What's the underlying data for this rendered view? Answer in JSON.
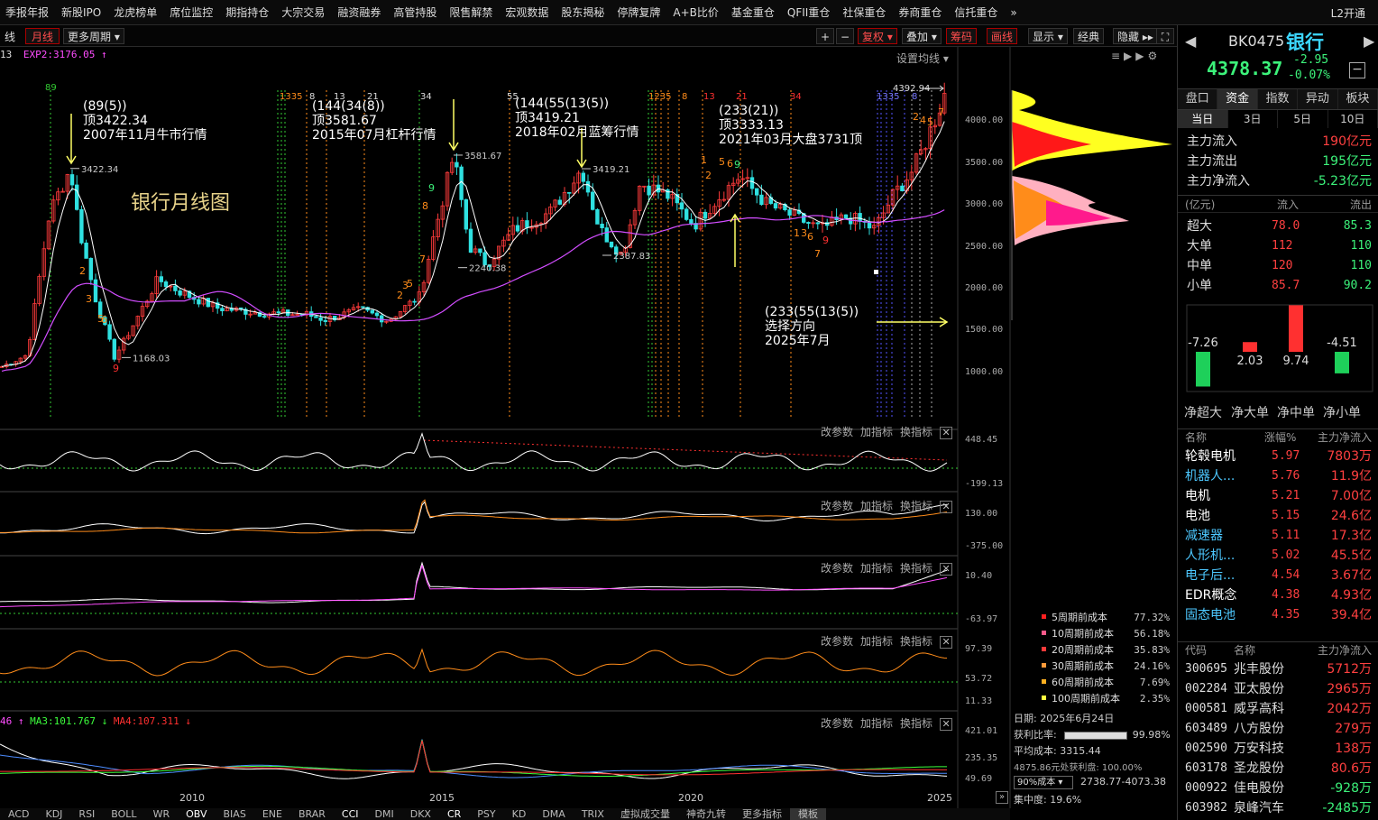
{
  "nav": [
    "季报年报",
    "新股IPO",
    "龙虎榜单",
    "席位监控",
    "期指持仓",
    "大宗交易",
    "融资融券",
    "高管持股",
    "限售解禁",
    "宏观数据",
    "股东揭秘",
    "停牌复牌",
    "A+B比价",
    "基金重仓",
    "QFII重仓",
    "社保重仓",
    "券商重仓",
    "信托重仓"
  ],
  "nav_more": "»",
  "top_right": "L2开通",
  "toolbar": {
    "left_cut": "线",
    "period": "月线",
    "more_period": "更多周期",
    "restore": "复权",
    "overlay": "叠加",
    "chips": "筹码",
    "draw": "画线",
    "display": "显示",
    "classic": "经典",
    "hide": "隐藏",
    "settings_ma": "设置均线"
  },
  "legend": {
    "prefix": "13",
    "exp2": "EXP2:3176.05",
    "bottom_prefix": "46",
    "ma3": "MA3:101.767",
    "ma4": "MA4:107.311"
  },
  "chart_title": "银行月线图",
  "annotations": [
    {
      "lines": [
        "(89(5))",
        "顶3422.34",
        "2007年11月牛市行情"
      ]
    },
    {
      "lines": [
        "(144(34(8))",
        "顶3581.67",
        "2015年07月杠杆行情"
      ]
    },
    {
      "lines": [
        "(144(55(13(5))",
        "顶3419.21",
        "2018年02月蓝筹行情"
      ]
    },
    {
      "lines": [
        "(233(21))",
        "顶3333.13",
        "2021年03月大盘3731顶"
      ]
    },
    {
      "lines": [
        "(233(55(13(5))",
        "选择方向",
        "2025年7月"
      ]
    }
  ],
  "price_labels": {
    "p1": "3422.34",
    "p2": "3581.67",
    "p3": "3419.21",
    "p4": "2387.83",
    "p5": "2240.38",
    "p6": "1168.03",
    "p7": "4392.94"
  },
  "fib_labels": [
    "89",
    "133",
    "5",
    "8",
    "13",
    "21",
    "34",
    "55",
    "123",
    "5",
    "8",
    "13",
    "21",
    "34",
    "1335",
    "8",
    "13"
  ],
  "count_labels": [
    "1",
    "2",
    "3",
    "4",
    "5",
    "6",
    "7",
    "8",
    "9"
  ],
  "main_axis": [
    "4000.00",
    "3500.00",
    "3000.00",
    "2500.00",
    "2000.00",
    "1500.00",
    "1000.00"
  ],
  "subs": [
    {
      "links": [
        "改参数",
        "加指标",
        "换指标"
      ],
      "axis": [
        "448.45",
        "-199.13"
      ]
    },
    {
      "links": [
        "改参数",
        "加指标",
        "换指标"
      ],
      "axis": [
        "130.00",
        "-375.00"
      ]
    },
    {
      "links": [
        "改参数",
        "加指标",
        "换指标"
      ],
      "axis": [
        "10.40",
        "-63.97"
      ]
    },
    {
      "links": [
        "改参数",
        "加指标",
        "换指标"
      ],
      "axis": [
        "97.39",
        "53.72",
        "11.33"
      ]
    },
    {
      "links": [
        "改参数",
        "加指标",
        "换指标"
      ],
      "axis": [
        "421.01",
        "235.35",
        "49.69"
      ]
    }
  ],
  "x_years": [
    "2010",
    "2015",
    "2020",
    "2025"
  ],
  "bottom_tabs": [
    "ACD",
    "KDJ",
    "RSI",
    "BOLL",
    "WR",
    "OBV",
    "BIAS",
    "ENE",
    "BRAR",
    "CCI",
    "DMI",
    "DKX",
    "CR",
    "PSY",
    "KD",
    "DMA",
    "TRIX",
    "虚拟成交量",
    "神奇九转",
    "更多指标",
    "模板"
  ],
  "cost": {
    "rows": [
      {
        "label": "5周期前成本",
        "val": "77.32%",
        "color": "#ff2020"
      },
      {
        "label": "10周期前成本",
        "val": "56.18%",
        "color": "#ff5a8a"
      },
      {
        "label": "20周期前成本",
        "val": "35.83%",
        "color": "#ff3a3a"
      },
      {
        "label": "30周期前成本",
        "val": "24.16%",
        "color": "#ff9a3a"
      },
      {
        "label": "60周期前成本",
        "val": "7.69%",
        "color": "#ffb020"
      },
      {
        "label": "100周期前成本",
        "val": "2.35%",
        "color": "#ffff40"
      }
    ],
    "date": "日期: 2025年6月24日",
    "profit_label": "获利比率:",
    "profit_val": "99.98%",
    "avg": "平均成本: 3315.44",
    "profit_at": "4875.86元处获利盘: 100.00%",
    "range_sel": "90%成本",
    "range": "2738.77-4073.38",
    "conc": "集中度: 19.6%"
  },
  "right": {
    "code": "BK0475",
    "name": "银行",
    "price": "4378.37",
    "chg": "-2.95",
    "pct": "-0.07%",
    "tabs": [
      "盘口",
      "资金",
      "指数",
      "异动",
      "板块"
    ],
    "periods": [
      "当日",
      "3日",
      "5日",
      "10日"
    ],
    "flows": [
      {
        "label": "主力流入",
        "val": "190亿元"
      },
      {
        "label": "主力流出",
        "val": "195亿元"
      },
      {
        "label": "主力净流入",
        "val": "-5.23亿元"
      }
    ],
    "fhead": [
      "(亿元)",
      "流入",
      "流出"
    ],
    "frows": [
      {
        "n": "超大",
        "in": "78.0",
        "out": "85.3"
      },
      {
        "n": "大单",
        "in": "112",
        "out": "110"
      },
      {
        "n": "中单",
        "in": "120",
        "out": "110"
      },
      {
        "n": "小单",
        "in": "85.7",
        "out": "90.2"
      }
    ],
    "bars": [
      {
        "label": "净超大",
        "val": -7.26
      },
      {
        "label": "净大单",
        "val": 2.03
      },
      {
        "label": "净中单",
        "val": 9.74
      },
      {
        "label": "净小单",
        "val": -4.51
      }
    ],
    "shead": [
      "名称",
      "涨幅%",
      "主力净流入"
    ],
    "sectors": [
      {
        "n": "轮毂电机",
        "p": "5.97",
        "f": "7803万",
        "c": "#fff"
      },
      {
        "n": "机器人...",
        "p": "5.76",
        "f": "11.9亿",
        "c": "#4dc8ff"
      },
      {
        "n": "电机",
        "p": "5.21",
        "f": "7.00亿",
        "c": "#fff"
      },
      {
        "n": "电池",
        "p": "5.15",
        "f": "24.6亿",
        "c": "#fff"
      },
      {
        "n": "减速器",
        "p": "5.11",
        "f": "17.3亿",
        "c": "#4dc8ff"
      },
      {
        "n": "人形机...",
        "p": "5.02",
        "f": "45.5亿",
        "c": "#4dc8ff"
      },
      {
        "n": "电子后...",
        "p": "4.54",
        "f": "3.67亿",
        "c": "#4dc8ff"
      },
      {
        "n": "EDR概念",
        "p": "4.38",
        "f": "4.93亿",
        "c": "#fff"
      },
      {
        "n": "固态电池",
        "p": "4.35",
        "f": "39.4亿",
        "c": "#4dc8ff"
      }
    ],
    "thead": [
      "代码",
      "名称",
      "主力净流入"
    ],
    "stocks": [
      {
        "c": "300695",
        "n": "兆丰股份",
        "f": "5712万",
        "neg": false
      },
      {
        "c": "002284",
        "n": "亚太股份",
        "f": "2965万",
        "neg": false
      },
      {
        "c": "000581",
        "n": "威孚高科",
        "f": "2042万",
        "neg": false
      },
      {
        "c": "603489",
        "n": "八方股份",
        "f": "279万",
        "neg": false
      },
      {
        "c": "002590",
        "n": "万安科技",
        "f": "138万",
        "neg": false
      },
      {
        "c": "603178",
        "n": "圣龙股份",
        "f": "80.6万",
        "neg": false
      },
      {
        "c": "000922",
        "n": "佳电股份",
        "f": "-928万",
        "neg": true
      },
      {
        "c": "603982",
        "n": "泉峰汽车",
        "f": "-2485万",
        "neg": true
      }
    ]
  }
}
